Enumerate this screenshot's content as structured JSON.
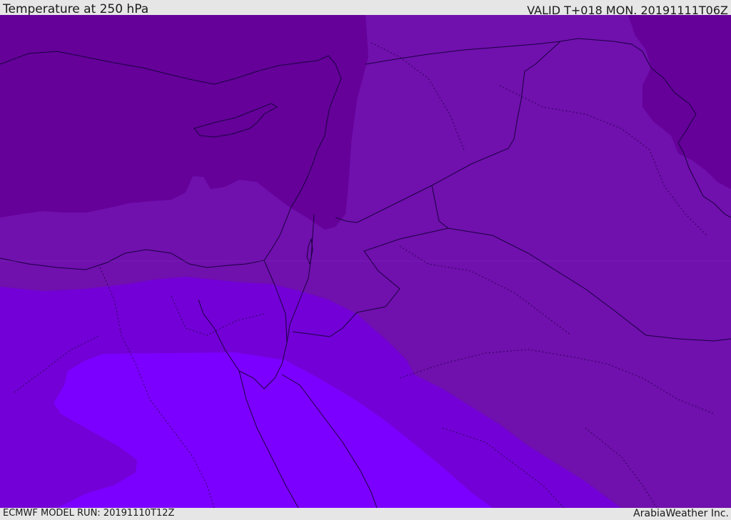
{
  "header": {
    "title": "Temperature at 250 hPa",
    "valid": "VALID T+018 MON. 20191111T06Z"
  },
  "footer": {
    "model_run": "ECMWF MODEL RUN: 20191110T12Z",
    "credit": "ArabiaWeather Inc."
  },
  "map": {
    "colors": {
      "band_darkest": "#650099",
      "band_dark": "#7010ad",
      "band_mid": "#7300d6",
      "band_bright": "#7c00ff",
      "borders": "#1a0040"
    }
  }
}
